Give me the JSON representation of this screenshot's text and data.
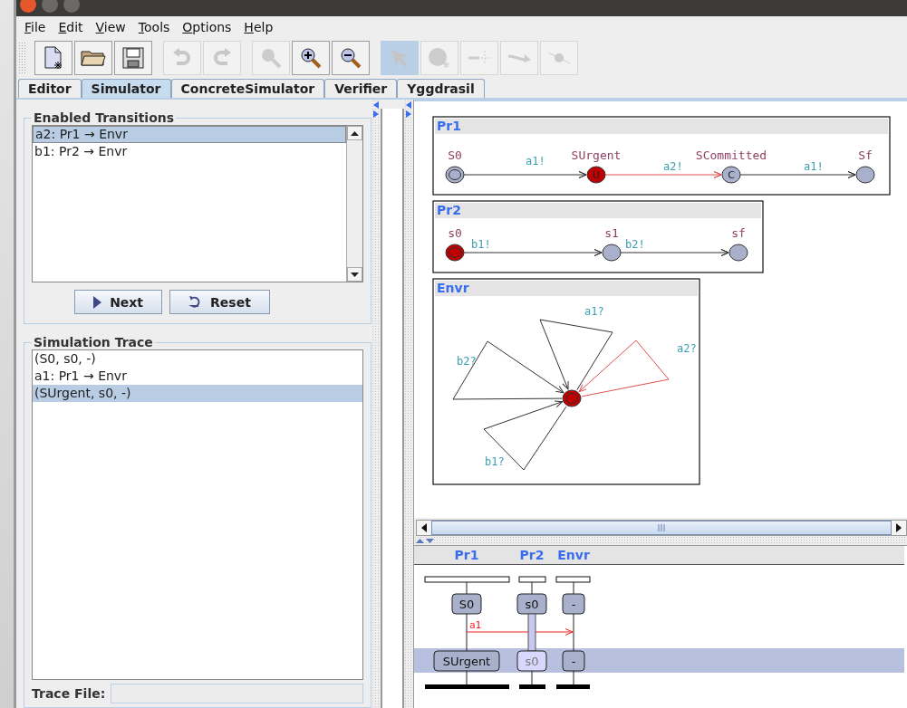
{
  "menu": [
    {
      "label": "File"
    },
    {
      "label": "Edit"
    },
    {
      "label": "View"
    },
    {
      "label": "Tools"
    },
    {
      "label": "Options"
    },
    {
      "label": "Help"
    }
  ],
  "toolbar": [
    {
      "kind": "new",
      "disabled": false,
      "selected": false
    },
    {
      "kind": "open",
      "disabled": false,
      "selected": false
    },
    {
      "kind": "save",
      "disabled": false,
      "selected": false
    },
    {
      "kind": "undo",
      "disabled": true,
      "selected": false
    },
    {
      "kind": "redo",
      "disabled": true,
      "selected": false
    },
    {
      "kind": "zoom",
      "disabled": true,
      "selected": false
    },
    {
      "kind": "zoom-in",
      "disabled": false,
      "selected": false
    },
    {
      "kind": "zoom-out",
      "disabled": false,
      "selected": false
    },
    {
      "kind": "select",
      "disabled": true,
      "selected": true
    },
    {
      "kind": "location",
      "disabled": true,
      "selected": false
    },
    {
      "kind": "branch",
      "disabled": true,
      "selected": false
    },
    {
      "kind": "edge",
      "disabled": true,
      "selected": false
    },
    {
      "kind": "nail",
      "disabled": true,
      "selected": false
    }
  ],
  "tabs": [
    {
      "label": "Editor",
      "selected": false
    },
    {
      "label": "Simulator",
      "selected": true
    },
    {
      "label": "ConcreteSimulator",
      "selected": false
    },
    {
      "label": "Verifier",
      "selected": false
    },
    {
      "label": "Yggdrasil",
      "selected": false
    }
  ],
  "enabled_transitions": {
    "title": "Enabled Transitions",
    "items": [
      {
        "text": "a2: Pr1 → Envr",
        "selected": true
      },
      {
        "text": "b1: Pr2 → Envr",
        "selected": false
      }
    ]
  },
  "buttons": [
    {
      "kind": "next",
      "label": "Next"
    },
    {
      "kind": "reset",
      "label": "Reset"
    }
  ],
  "simulation_trace": {
    "title": "Simulation Trace",
    "items": [
      {
        "text": "(S0, s0, -)",
        "selected": false
      },
      {
        "text": "a1: Pr1 → Envr",
        "selected": false
      },
      {
        "text": "(SUrgent, s0, -)",
        "selected": true
      }
    ]
  },
  "trace_file": {
    "label": "Trace File:"
  },
  "templates": [
    {
      "name": "Pr1",
      "locations": [
        {
          "name": "S0",
          "kind": "initial",
          "active": false
        },
        {
          "name": "SUrgent",
          "kind": "urgent",
          "symbol": "U",
          "active": true
        },
        {
          "name": "SCommitted",
          "kind": "committed",
          "symbol": "C",
          "active": false
        },
        {
          "name": "Sf",
          "kind": "normal",
          "active": false
        }
      ],
      "edges": [
        {
          "label": "a1!",
          "highlighted": false
        },
        {
          "label": "a2!",
          "highlighted": true
        },
        {
          "label": "a1!",
          "highlighted": false
        }
      ]
    },
    {
      "name": "Pr2",
      "locations": [
        {
          "name": "s0",
          "kind": "initial",
          "active": true
        },
        {
          "name": "s1",
          "kind": "normal",
          "active": false
        },
        {
          "name": "sf",
          "kind": "normal",
          "active": false
        }
      ],
      "edges": [
        {
          "label": "b1!",
          "highlighted": false
        },
        {
          "label": "b2!",
          "highlighted": false
        }
      ]
    },
    {
      "name": "Envr",
      "locations": [
        {
          "kind": "initial",
          "active": true
        }
      ],
      "edges": [
        {
          "label": "a1?",
          "highlighted": false
        },
        {
          "label": "a2?",
          "highlighted": true
        },
        {
          "label": "b2?",
          "highlighted": false
        },
        {
          "label": "b1?",
          "highlighted": false
        }
      ]
    }
  ],
  "msc": {
    "processes": [
      {
        "name": "Pr1"
      },
      {
        "name": "Pr2"
      },
      {
        "name": "Envr"
      }
    ],
    "rows": [
      {
        "selected": false,
        "states": [
          {
            "text": "S0",
            "faded": false
          },
          {
            "text": "s0",
            "faded": false
          },
          {
            "text": "-",
            "faded": false
          }
        ],
        "message": {
          "label": "a1"
        }
      },
      {
        "selected": true,
        "states": [
          {
            "text": "SUrgent",
            "faded": false
          },
          {
            "text": "s0",
            "faded": true
          },
          {
            "text": "-",
            "faded": false
          }
        ]
      }
    ]
  }
}
